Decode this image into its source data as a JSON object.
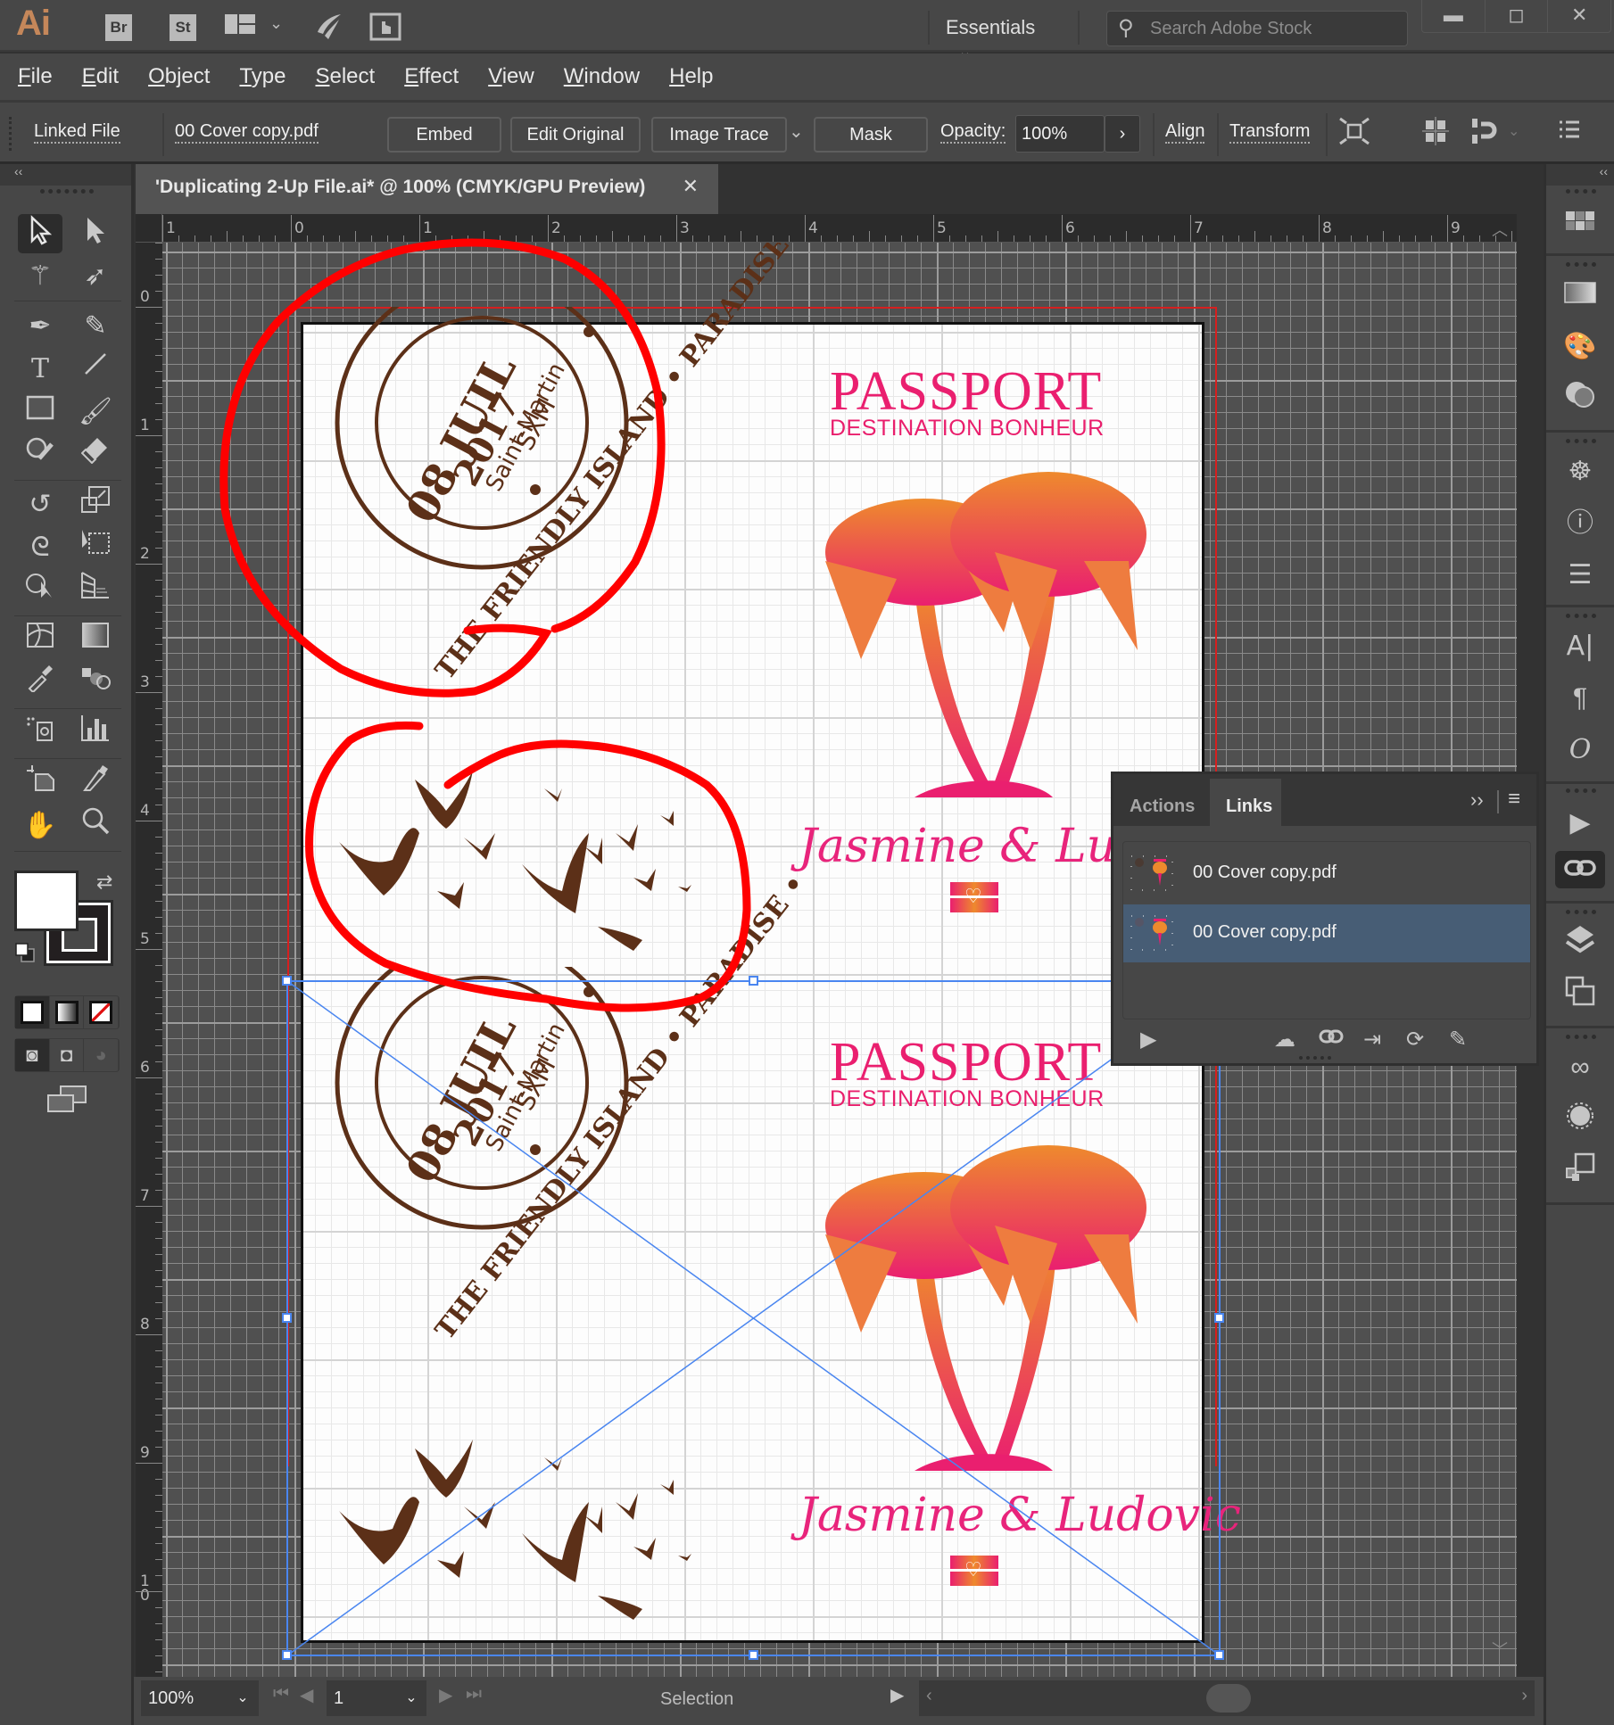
{
  "titlebar": {
    "app_logo": "Ai",
    "bridge_label": "Br",
    "stock_label": "St",
    "workspace": "Essentials",
    "search_placeholder": "Search Adobe Stock",
    "window_controls": [
      "minimize",
      "maximize",
      "close"
    ]
  },
  "menubar": {
    "items": [
      "File",
      "Edit",
      "Object",
      "Type",
      "Select",
      "Effect",
      "View",
      "Window",
      "Help"
    ]
  },
  "controlbar": {
    "object_type": "Linked File",
    "file_name": "00 Cover copy.pdf",
    "embed_label": "Embed",
    "edit_original_label": "Edit Original",
    "image_trace_label": "Image Trace",
    "mask_label": "Mask",
    "opacity_label": "Opacity:",
    "opacity_value": "100%",
    "align_label": "Align",
    "transform_label": "Transform"
  },
  "document": {
    "tab_title": "'Duplicating 2-Up File.ai* @ 100% (CMYK/GPU Preview)",
    "close_glyph": "✕"
  },
  "rulers": {
    "horizontal": [
      "1",
      "0",
      "1",
      "2",
      "3",
      "4",
      "5",
      "6",
      "7",
      "8",
      "9"
    ],
    "vertical": [
      "0",
      "1",
      "2",
      "3",
      "4",
      "5",
      "6",
      "7",
      "8",
      "9",
      "10"
    ]
  },
  "artwork": {
    "stamp": {
      "outer_ring": "THE FRIENDLY ISLAND • PARADISE •",
      "date": "08 JUIL",
      "year": "2017",
      "place": "Saint-Martin",
      "code": "SXM"
    },
    "title": "PASSPORT",
    "subtitle": "DESTINATION BONHEUR",
    "names": "Jasmine & Ludovic",
    "brown": "#5c3018",
    "pink": "#ea1f6f",
    "orange": "#ee8a2d",
    "annotation_red": "#ff0000"
  },
  "links_panel": {
    "tabs": [
      "Actions",
      "Links"
    ],
    "active_tab": "Links",
    "items": [
      {
        "name": "00 Cover copy.pdf",
        "selected": false
      },
      {
        "name": "00 Cover copy.pdf",
        "selected": true
      }
    ]
  },
  "statusbar": {
    "zoom": "100%",
    "artboard_number": "1",
    "tool_name": "Selection"
  }
}
